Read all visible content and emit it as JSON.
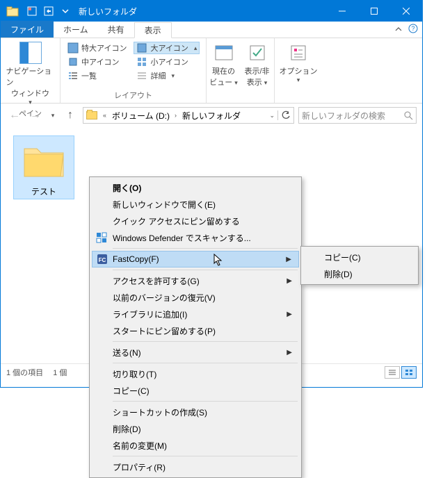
{
  "title": "新しいフォルダ",
  "tabs": {
    "file": "ファイル",
    "home": "ホーム",
    "share": "共有",
    "view": "表示"
  },
  "ribbon": {
    "pane_group": "ペイン",
    "nav_pane1": "ナビゲーション",
    "nav_pane2": "ウィンドウ",
    "layout_group": "レイアウト",
    "l_xl": "特大アイコン",
    "l_lg": "大アイコン",
    "l_md": "中アイコン",
    "l_sm": "小アイコン",
    "l_list": "一覧",
    "l_detail": "詳細",
    "cur1": "現在の",
    "cur2": "ビュー",
    "show1": "表示/非",
    "show2": "表示",
    "options": "オプション"
  },
  "address": {
    "seg1": "ボリューム (D:)",
    "seg2": "新しいフォルダ",
    "search_ph": "新しいフォルダの検索"
  },
  "item": {
    "name": "テスト"
  },
  "status": {
    "count": "1 個の項目",
    "sel": "1 個"
  },
  "ctx": {
    "open": "開く(O)",
    "open_new": "新しいウィンドウで開く(E)",
    "pin_quick": "クイック アクセスにピン留めする",
    "defender": "Windows Defender でスキャンする...",
    "fastcopy": "FastCopy(F)",
    "grant": "アクセスを許可する(G)",
    "restore": "以前のバージョンの復元(V)",
    "library": "ライブラリに追加(I)",
    "pin_start": "スタートにピン留めする(P)",
    "send": "送る(N)",
    "cut": "切り取り(T)",
    "copy": "コピー(C)",
    "shortcut": "ショートカットの作成(S)",
    "delete": "削除(D)",
    "rename": "名前の変更(M)",
    "props": "プロパティ(R)"
  },
  "sub": {
    "copy": "コピー(C)",
    "delete": "削除(D)"
  }
}
